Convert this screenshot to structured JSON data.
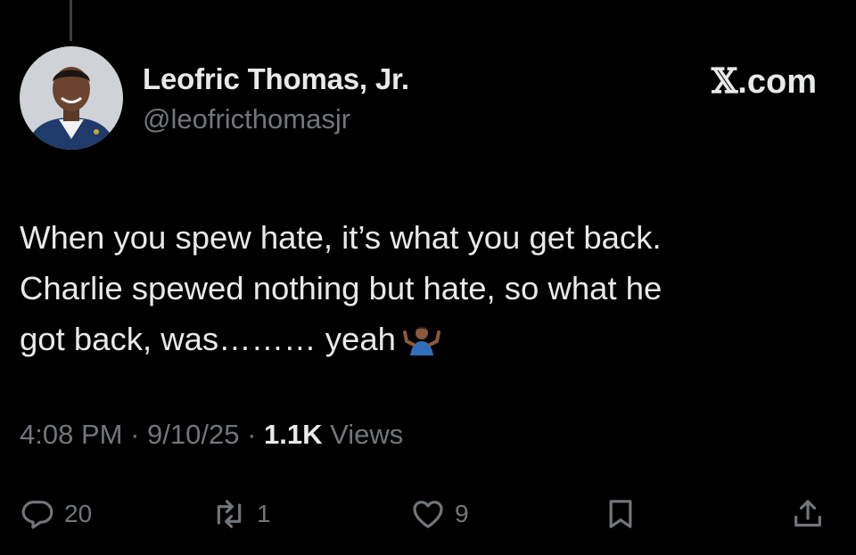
{
  "author": {
    "name": "Leofric Thomas, Jr.",
    "handle": "@leofricthomasjr"
  },
  "site": {
    "glyph": "𝕏",
    "domain": ".com"
  },
  "tweet": {
    "lines": [
      "When you spew hate, it’s what you get back.",
      "Charlie spewed nothing but hate, so what he",
      "got back, was……… yeah"
    ],
    "emoji": "shrug"
  },
  "meta": {
    "time": "4:08 PM",
    "separator": " · ",
    "date": "9/10/25",
    "views_count": "1.1K",
    "views_label": " Views"
  },
  "actions": {
    "replies": "20",
    "reposts": "1",
    "likes": "9"
  },
  "colors": {
    "background": "#000000",
    "text": "#e7e9ea",
    "secondary": "#71767b"
  }
}
